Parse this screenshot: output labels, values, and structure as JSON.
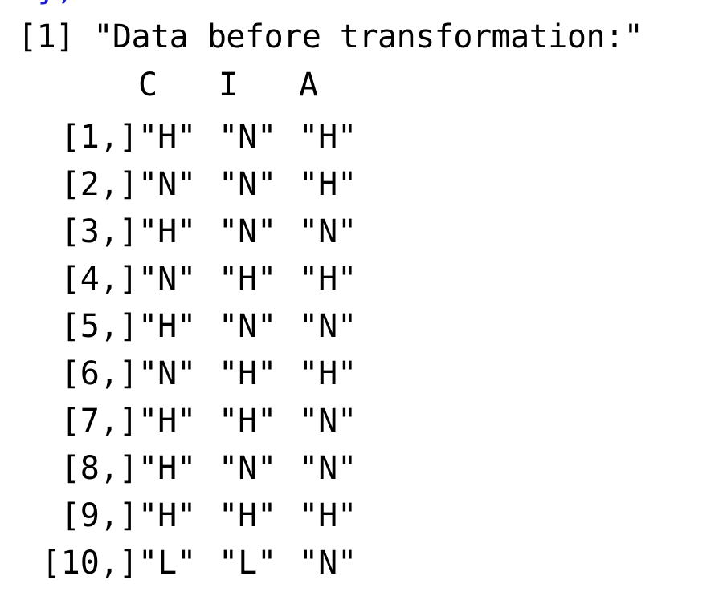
{
  "console": {
    "prev_line": "…})",
    "print_output": "[1] \"Data before transformation:\"",
    "matrix": {
      "col_headers": [
        "C",
        "I",
        "A"
      ],
      "rows": [
        {
          "name": "[1,]",
          "cells": [
            "\"H\"",
            "\"N\"",
            "\"H\""
          ]
        },
        {
          "name": "[2,]",
          "cells": [
            "\"N\"",
            "\"N\"",
            "\"H\""
          ]
        },
        {
          "name": "[3,]",
          "cells": [
            "\"H\"",
            "\"N\"",
            "\"N\""
          ]
        },
        {
          "name": "[4,]",
          "cells": [
            "\"N\"",
            "\"H\"",
            "\"H\""
          ]
        },
        {
          "name": "[5,]",
          "cells": [
            "\"H\"",
            "\"N\"",
            "\"N\""
          ]
        },
        {
          "name": "[6,]",
          "cells": [
            "\"N\"",
            "\"H\"",
            "\"H\""
          ]
        },
        {
          "name": "[7,]",
          "cells": [
            "\"H\"",
            "\"H\"",
            "\"N\""
          ]
        },
        {
          "name": "[8,]",
          "cells": [
            "\"H\"",
            "\"N\"",
            "\"N\""
          ]
        },
        {
          "name": "[9,]",
          "cells": [
            "\"H\"",
            "\"H\"",
            "\"H\""
          ]
        },
        {
          "name": "[10,]",
          "cells": [
            "\"L\"",
            "\"L\"",
            "\"N\""
          ]
        }
      ]
    },
    "colors": {
      "text": "#000000",
      "code": "#1f1fd6",
      "background": "#ffffff"
    }
  }
}
